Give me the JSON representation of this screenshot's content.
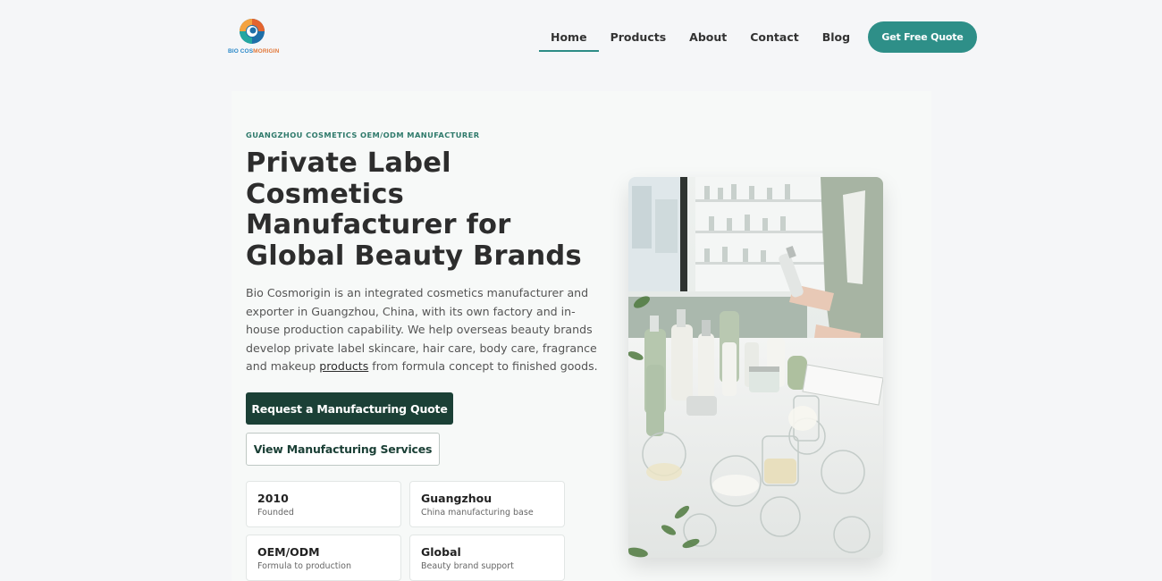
{
  "header": {
    "logo_text_part1": "BIO COS",
    "logo_text_part2": "MORIGIN",
    "nav": [
      {
        "label": "Home",
        "active": true
      },
      {
        "label": "Products",
        "active": false
      },
      {
        "label": "About",
        "active": false
      },
      {
        "label": "Contact",
        "active": false
      },
      {
        "label": "Blog",
        "active": false
      }
    ],
    "cta": "Get Free Quote"
  },
  "hero": {
    "eyebrow": "GUANGZHOU COSMETICS OEM/ODM MANUFACTURER",
    "headline": "Private Label Cosmetics Manufacturer for Global Beauty Brands",
    "description_before_link": "Bio Cosmorigin is an integrated cosmetics manufacturer and exporter in Guangzhou, China, with its own factory and in-house production capability. We help overseas beauty brands develop private label skincare, hair care, body care, fragrance and makeup ",
    "description_link": "products",
    "description_after_link": " from formula concept to finished goods.",
    "primary_button": "Request a Manufacturing Quote",
    "secondary_button": "View Manufacturing Services",
    "stats": [
      {
        "value": "2010",
        "label": "Founded"
      },
      {
        "value": "Guangzhou",
        "label": "China manufacturing base"
      },
      {
        "value": "OEM/ODM",
        "label": "Formula to production"
      },
      {
        "value": "Global",
        "label": "Beauty brand support"
      }
    ]
  },
  "colors": {
    "accent": "#2e8f88",
    "dark_green": "#1b4036",
    "eyebrow": "#2f7a6b",
    "background": "#f5f6f8"
  },
  "icons": {
    "logo": "swirl-logo-icon"
  }
}
